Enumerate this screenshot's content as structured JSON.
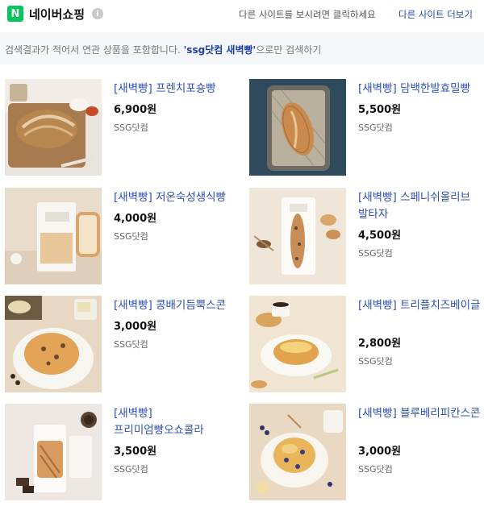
{
  "header": {
    "logo_letter": "N",
    "brand": "네이버쇼핑",
    "info_icon": "i",
    "other_sites_text": "다른 사이트를 보시려면 클릭하세요",
    "other_sites_link": "다른 사이트 더보기"
  },
  "notice": {
    "prefix": "검색결과가 적어서 연관 상품을 포함합니다.",
    "keyword": "'ssg닷컴 새벽빵'",
    "suffix": "으로만 검색하기"
  },
  "products": [
    {
      "title": "[새벽빵] 프렌치포숑빵",
      "price": "6,900원",
      "seller": "SSG닷컴",
      "image": "french-bread-board"
    },
    {
      "title": "[새벽빵] 담백한발효밀빵",
      "price": "5,500원",
      "seller": "SSG닷컴",
      "image": "wheat-loaf-tray"
    },
    {
      "title": "[새벽빵] 저온숙성생식빵",
      "price": "4,000원",
      "seller": "SSG닷컴",
      "image": "bread-bag"
    },
    {
      "title": "[새벽빵] 스페니쉬올리브 발타자",
      "price": "4,500원",
      "seller": "SSG닷컴",
      "image": "olive-bread-bag"
    },
    {
      "title": "[새벽빵] 콩배기듬뿍스콘",
      "price": "3,000원",
      "seller": "SSG닷컴",
      "image": "bean-scone-plate"
    },
    {
      "title": "[새벽빵] 트리플치즈베이글",
      "price": "2,800원",
      "seller": "SSG닷컴",
      "image": "cheese-bagel-plate"
    },
    {
      "title": "[새벽빵] 프리미엄빵오쇼콜라",
      "price": "3,500원",
      "seller": "SSG닷컴",
      "image": "chocolate-bread-bag"
    },
    {
      "title": "[새벽빵] 블루베리피칸스콘",
      "price": "3,000원",
      "seller": "SSG닷컴",
      "image": "blueberry-scone-plate"
    }
  ],
  "colors": {
    "link": "#2d50b7",
    "brand_green": "#03c75a",
    "notice_bg": "#f5f6f8"
  }
}
